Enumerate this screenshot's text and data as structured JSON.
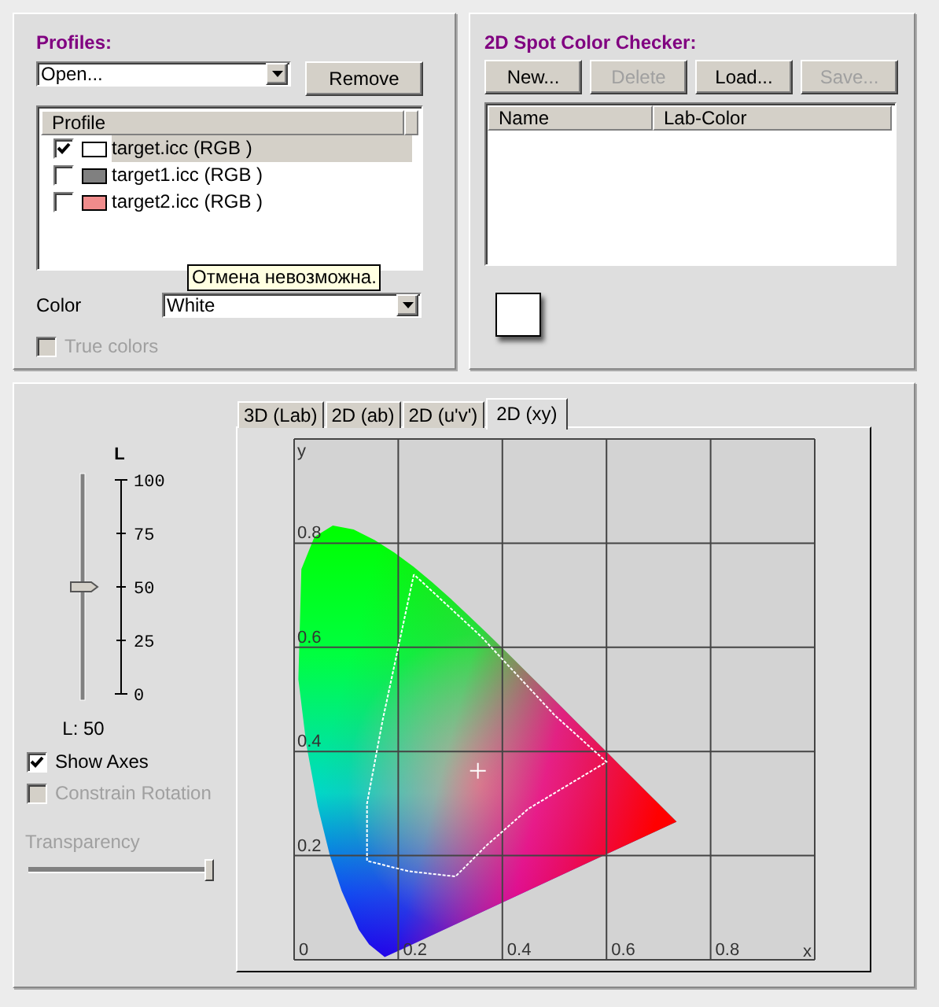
{
  "profiles_panel": {
    "title": "Profiles:",
    "open_select": {
      "value": "Open..."
    },
    "remove_button": "Remove",
    "list": {
      "column": "Profile",
      "rows": [
        {
          "name": "target.icc (RGB )",
          "checked": true,
          "selected": true,
          "color": "#ffffff"
        },
        {
          "name": "target1.icc (RGB )",
          "checked": false,
          "selected": false,
          "color": "#808080"
        },
        {
          "name": "target2.icc (RGB )",
          "checked": false,
          "selected": false,
          "color": "#f08c8c"
        }
      ]
    },
    "tooltip": "Отмена невозможна.",
    "color_label": "Color",
    "color_select": {
      "value": "White"
    },
    "true_colors": {
      "label": "True colors",
      "checked": false,
      "disabled": true
    }
  },
  "spot_panel": {
    "title": "2D Spot Color Checker:",
    "buttons": [
      {
        "label": "New...",
        "disabled": false
      },
      {
        "label": "Delete",
        "disabled": true
      },
      {
        "label": "Load...",
        "disabled": false
      },
      {
        "label": "Save...",
        "disabled": true
      }
    ],
    "table": {
      "columns": [
        "Name",
        "Lab-Color"
      ]
    }
  },
  "view_panel": {
    "l_slider": {
      "title": "L",
      "ticks": [
        "100",
        "75",
        "50",
        "25",
        "0"
      ],
      "level": 0.5,
      "reading": "L: 50"
    },
    "options": [
      {
        "label": "Show Axes",
        "checked": true,
        "disabled": false
      },
      {
        "label": "Constrain Rotation",
        "checked": false,
        "disabled": true
      }
    ],
    "transparency": {
      "label": "Transparency",
      "level": 1
    },
    "tabs": [
      {
        "label": "3D (Lab)",
        "selected": false
      },
      {
        "label": "2D (ab)",
        "selected": false
      },
      {
        "label": "2D (u'v')",
        "selected": false
      },
      {
        "label": "2D (xy)",
        "selected": true
      }
    ],
    "plot": {
      "y_axis_label": "y",
      "x_axis_label": "x",
      "y_ticks": [
        "0.8",
        "0.6",
        "0.4",
        "0.2"
      ],
      "x_ticks": [
        "0",
        "0.2",
        "0.4",
        "0.6",
        "0.8"
      ]
    }
  }
}
